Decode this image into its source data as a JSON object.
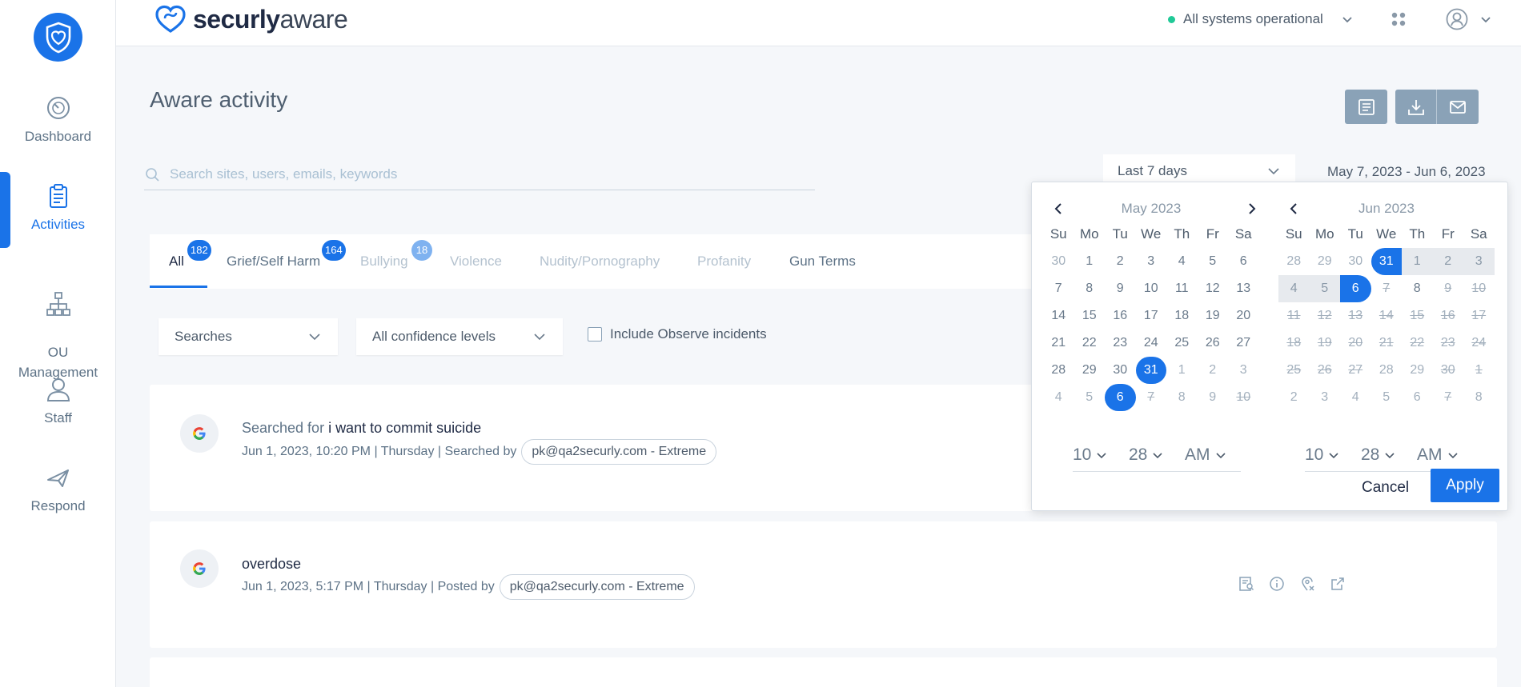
{
  "sidebar": {
    "items": [
      {
        "label": "Dashboard",
        "icon": "gauge-icon"
      },
      {
        "label": "Activities",
        "icon": "clipboard-icon"
      },
      {
        "label": "OU\nManagement",
        "icon": "org-chart-icon"
      },
      {
        "label": "Staff",
        "icon": "user-icon"
      },
      {
        "label": "Respond",
        "icon": "send-icon"
      }
    ],
    "active_index": 1
  },
  "header": {
    "brand_bold": "securly",
    "brand_light": "aware",
    "status_text": "All systems operational"
  },
  "page": {
    "title": "Aware activity",
    "search_placeholder": "Search sites, users, emails, keywords",
    "date_preset": "Last 7 days",
    "date_range": "May 7, 2023 -  Jun 6, 2023"
  },
  "tabs": [
    {
      "label": "All",
      "badge": "182"
    },
    {
      "label": "Grief/Self Harm",
      "badge": "164"
    },
    {
      "label": "Bullying",
      "badge": "18"
    },
    {
      "label": "Violence",
      "badge": ""
    },
    {
      "label": "Nudity/Pornography",
      "badge": ""
    },
    {
      "label": "Profanity",
      "badge": ""
    },
    {
      "label": "Gun Terms",
      "badge": ""
    }
  ],
  "filters": {
    "type": "Searches",
    "confidence": "All confidence levels",
    "observe_label": "Include Observe incidents"
  },
  "activities": [
    {
      "prefix": "Searched for ",
      "query": "i want to commit suicide",
      "meta": "Jun 1, 2023, 10:20 PM | Thursday | Searched by",
      "user": "pk@qa2securly.com - Extreme"
    },
    {
      "prefix": "",
      "query": "overdose",
      "meta": "Jun 1, 2023, 5:17 PM | Thursday | Posted by",
      "user": "pk@qa2securly.com - Extreme"
    }
  ],
  "datepicker": {
    "dow": [
      "Su",
      "Mo",
      "Tu",
      "We",
      "Th",
      "Fr",
      "Sa"
    ],
    "left": {
      "month": "May 2023",
      "weeks": [
        [
          [
            "30",
            "off"
          ],
          [
            "1",
            ""
          ],
          [
            "2",
            ""
          ],
          [
            "3",
            ""
          ],
          [
            "4",
            ""
          ],
          [
            "5",
            ""
          ],
          [
            "6",
            ""
          ]
        ],
        [
          [
            "7",
            ""
          ],
          [
            "8",
            ""
          ],
          [
            "9",
            ""
          ],
          [
            "10",
            ""
          ],
          [
            "11",
            ""
          ],
          [
            "12",
            ""
          ],
          [
            "13",
            ""
          ]
        ],
        [
          [
            "14",
            ""
          ],
          [
            "15",
            ""
          ],
          [
            "16",
            ""
          ],
          [
            "17",
            ""
          ],
          [
            "18",
            ""
          ],
          [
            "19",
            ""
          ],
          [
            "20",
            ""
          ]
        ],
        [
          [
            "21",
            ""
          ],
          [
            "22",
            ""
          ],
          [
            "23",
            ""
          ],
          [
            "24",
            ""
          ],
          [
            "25",
            ""
          ],
          [
            "26",
            ""
          ],
          [
            "27",
            ""
          ]
        ],
        [
          [
            "28",
            ""
          ],
          [
            "29",
            ""
          ],
          [
            "30",
            ""
          ],
          [
            "31",
            "sel"
          ],
          [
            "1",
            "off"
          ],
          [
            "2",
            "off"
          ],
          [
            "3",
            "off"
          ]
        ],
        [
          [
            "4",
            "off"
          ],
          [
            "5",
            "off"
          ],
          [
            "6",
            "sel"
          ],
          [
            "7",
            "dis"
          ],
          [
            "8",
            "off"
          ],
          [
            "9",
            "off"
          ],
          [
            "10",
            "dis"
          ]
        ]
      ],
      "time": {
        "hour": "10",
        "minute": "28",
        "ampm": "AM"
      }
    },
    "right": {
      "month": "Jun 2023",
      "weeks": [
        [
          [
            "28",
            "off"
          ],
          [
            "29",
            "off"
          ],
          [
            "30",
            "off"
          ],
          [
            "31",
            "sel start"
          ],
          [
            "1",
            "range"
          ],
          [
            "2",
            "range"
          ],
          [
            "3",
            "range"
          ]
        ],
        [
          [
            "4",
            "range"
          ],
          [
            "5",
            "range"
          ],
          [
            "6",
            "sel end"
          ],
          [
            "7",
            "dis"
          ],
          [
            "8",
            ""
          ],
          [
            "9",
            "dis"
          ],
          [
            "10",
            "dis"
          ]
        ],
        [
          [
            "11",
            "dis"
          ],
          [
            "12",
            "dis"
          ],
          [
            "13",
            "dis"
          ],
          [
            "14",
            "dis"
          ],
          [
            "15",
            "dis"
          ],
          [
            "16",
            "dis"
          ],
          [
            "17",
            "dis"
          ]
        ],
        [
          [
            "18",
            "dis"
          ],
          [
            "19",
            "dis"
          ],
          [
            "20",
            "dis"
          ],
          [
            "21",
            "dis"
          ],
          [
            "22",
            "dis"
          ],
          [
            "23",
            "dis"
          ],
          [
            "24",
            "dis"
          ]
        ],
        [
          [
            "25",
            "dis"
          ],
          [
            "26",
            "dis"
          ],
          [
            "27",
            "dis"
          ],
          [
            "28",
            "off"
          ],
          [
            "29",
            "off"
          ],
          [
            "30",
            "dis"
          ],
          [
            "1",
            "dis"
          ]
        ],
        [
          [
            "2",
            "off"
          ],
          [
            "3",
            "off"
          ],
          [
            "4",
            "off"
          ],
          [
            "5",
            "off"
          ],
          [
            "6",
            "off"
          ],
          [
            "7",
            "dis"
          ],
          [
            "8",
            "off"
          ]
        ]
      ],
      "time": {
        "hour": "10",
        "minute": "28",
        "ampm": "AM"
      }
    },
    "cancel_label": "Cancel",
    "apply_label": "Apply"
  },
  "colors": {
    "accent": "#1a73e8",
    "status_ok": "#20c997",
    "toolbar": "#8aa2b7"
  }
}
